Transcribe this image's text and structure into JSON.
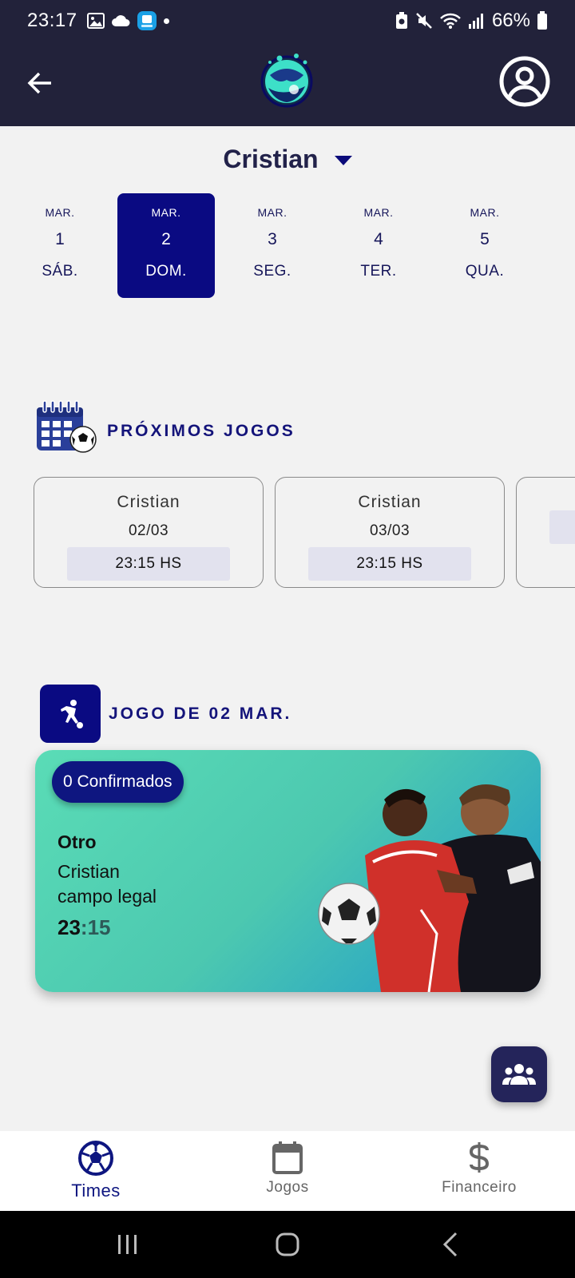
{
  "status_bar": {
    "time": "23:17",
    "battery": "66%"
  },
  "header": {
    "logo": "soccer-ball-logo",
    "back_icon": "arrow-left-icon",
    "profile_icon": "account-circle-icon"
  },
  "team_selector": {
    "name": "Cristian"
  },
  "date_strip": [
    {
      "month": "MAR.",
      "day": "1",
      "weekday": "SÁB.",
      "selected": false
    },
    {
      "month": "MAR.",
      "day": "2",
      "weekday": "DOM.",
      "selected": true
    },
    {
      "month": "MAR.",
      "day": "3",
      "weekday": "SEG.",
      "selected": false
    },
    {
      "month": "MAR.",
      "day": "4",
      "weekday": "TER.",
      "selected": false
    },
    {
      "month": "MAR.",
      "day": "5",
      "weekday": "QUA.",
      "selected": false
    }
  ],
  "upcoming": {
    "title": "PRÓXIMOS JOGOS",
    "games": [
      {
        "team": "Cristian",
        "date": "02/03",
        "time": "23:15 HS"
      },
      {
        "team": "Cristian",
        "date": "03/03",
        "time": "23:15 HS"
      },
      {
        "team": "",
        "date": "",
        "time": ""
      }
    ]
  },
  "day_game": {
    "title": "JOGO DE 02 MAR.",
    "confirmed": "0 Confirmados",
    "name": "Otro",
    "team": "Cristian",
    "field": "campo legal",
    "time_hours": "23",
    "time_sep_minutes": ":15"
  },
  "bottom_nav": [
    {
      "label": "Times",
      "icon": "soccer-ball-icon",
      "active": true
    },
    {
      "label": "Jogos",
      "icon": "calendar-icon",
      "active": false
    },
    {
      "label": "Financeiro",
      "icon": "dollar-icon",
      "active": false
    }
  ],
  "colors": {
    "header_bg": "#22223a",
    "accent": "#0a0a82",
    "card_gradient_start": "#5adcb6",
    "card_gradient_end": "#1d7fc6"
  }
}
